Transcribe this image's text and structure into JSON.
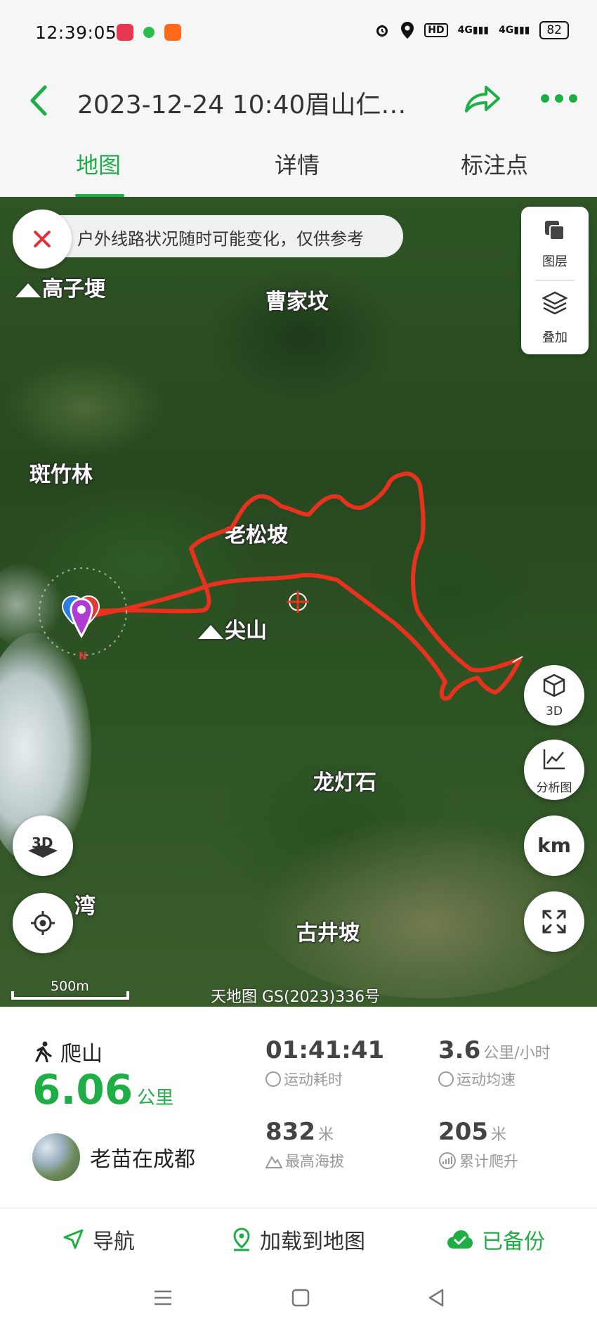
{
  "status_bar": {
    "time": "12:39:05",
    "signal_text": "4G",
    "signal2_text": "4G",
    "battery": "82"
  },
  "header": {
    "title": "2023-12-24 10:40眉山仁…"
  },
  "tabs": [
    {
      "label": "地图",
      "active": true
    },
    {
      "label": "详情",
      "active": false
    },
    {
      "label": "标注点",
      "active": false
    }
  ],
  "map": {
    "notice": "户外线路状况随时可能变化，仅供参考",
    "places": [
      "高子埂",
      "曹家坟",
      "斑竹林",
      "老松坡",
      "尖山",
      "龙灯石",
      "古井坡",
      "湾"
    ],
    "layer_panel": {
      "layers_label": "图层",
      "overlay_label": "叠加"
    },
    "buttons": {
      "three_d_label": "3D",
      "analysis_label": "分析图",
      "units_label": "km"
    },
    "scale": "500m",
    "copyright": "天地图 GS(2023)336号",
    "north": "N",
    "track_color": "#e8321e"
  },
  "stats": {
    "sport": "爬山",
    "distance": "6.06",
    "distance_unit": "公里",
    "user_name": "老苗在成都",
    "duration": "01:41:41",
    "duration_label": "运动耗时",
    "avg_speed": "3.6",
    "avg_speed_unit": "公里/小时",
    "avg_speed_label": "运动均速",
    "max_altitude": "832",
    "max_altitude_unit": "米",
    "max_altitude_label": "最高海拔",
    "total_climb": "205",
    "total_climb_unit": "米",
    "total_climb_label": "累计爬升"
  },
  "actions": {
    "navigate": "导航",
    "load_to_map": "加载到地图",
    "backed_up": "已备份"
  },
  "colors": {
    "accent": "#1fae45",
    "danger": "#e0323c"
  }
}
